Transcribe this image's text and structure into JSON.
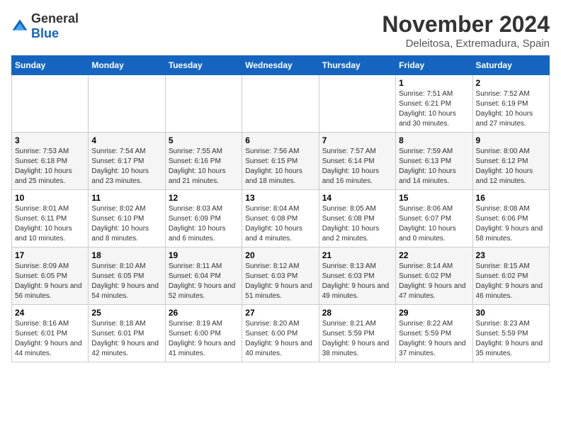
{
  "logo": {
    "general": "General",
    "blue": "Blue"
  },
  "title": {
    "month": "November 2024",
    "location": "Deleitosa, Extremadura, Spain"
  },
  "weekdays": [
    "Sunday",
    "Monday",
    "Tuesday",
    "Wednesday",
    "Thursday",
    "Friday",
    "Saturday"
  ],
  "weeks": [
    [
      {
        "day": "",
        "info": ""
      },
      {
        "day": "",
        "info": ""
      },
      {
        "day": "",
        "info": ""
      },
      {
        "day": "",
        "info": ""
      },
      {
        "day": "",
        "info": ""
      },
      {
        "day": "1",
        "info": "Sunrise: 7:51 AM\nSunset: 6:21 PM\nDaylight: 10 hours and 30 minutes."
      },
      {
        "day": "2",
        "info": "Sunrise: 7:52 AM\nSunset: 6:19 PM\nDaylight: 10 hours and 27 minutes."
      }
    ],
    [
      {
        "day": "3",
        "info": "Sunrise: 7:53 AM\nSunset: 6:18 PM\nDaylight: 10 hours and 25 minutes."
      },
      {
        "day": "4",
        "info": "Sunrise: 7:54 AM\nSunset: 6:17 PM\nDaylight: 10 hours and 23 minutes."
      },
      {
        "day": "5",
        "info": "Sunrise: 7:55 AM\nSunset: 6:16 PM\nDaylight: 10 hours and 21 minutes."
      },
      {
        "day": "6",
        "info": "Sunrise: 7:56 AM\nSunset: 6:15 PM\nDaylight: 10 hours and 18 minutes."
      },
      {
        "day": "7",
        "info": "Sunrise: 7:57 AM\nSunset: 6:14 PM\nDaylight: 10 hours and 16 minutes."
      },
      {
        "day": "8",
        "info": "Sunrise: 7:59 AM\nSunset: 6:13 PM\nDaylight: 10 hours and 14 minutes."
      },
      {
        "day": "9",
        "info": "Sunrise: 8:00 AM\nSunset: 6:12 PM\nDaylight: 10 hours and 12 minutes."
      }
    ],
    [
      {
        "day": "10",
        "info": "Sunrise: 8:01 AM\nSunset: 6:11 PM\nDaylight: 10 hours and 10 minutes."
      },
      {
        "day": "11",
        "info": "Sunrise: 8:02 AM\nSunset: 6:10 PM\nDaylight: 10 hours and 8 minutes."
      },
      {
        "day": "12",
        "info": "Sunrise: 8:03 AM\nSunset: 6:09 PM\nDaylight: 10 hours and 6 minutes."
      },
      {
        "day": "13",
        "info": "Sunrise: 8:04 AM\nSunset: 6:08 PM\nDaylight: 10 hours and 4 minutes."
      },
      {
        "day": "14",
        "info": "Sunrise: 8:05 AM\nSunset: 6:08 PM\nDaylight: 10 hours and 2 minutes."
      },
      {
        "day": "15",
        "info": "Sunrise: 8:06 AM\nSunset: 6:07 PM\nDaylight: 10 hours and 0 minutes."
      },
      {
        "day": "16",
        "info": "Sunrise: 8:08 AM\nSunset: 6:06 PM\nDaylight: 9 hours and 58 minutes."
      }
    ],
    [
      {
        "day": "17",
        "info": "Sunrise: 8:09 AM\nSunset: 6:05 PM\nDaylight: 9 hours and 56 minutes."
      },
      {
        "day": "18",
        "info": "Sunrise: 8:10 AM\nSunset: 6:05 PM\nDaylight: 9 hours and 54 minutes."
      },
      {
        "day": "19",
        "info": "Sunrise: 8:11 AM\nSunset: 6:04 PM\nDaylight: 9 hours and 52 minutes."
      },
      {
        "day": "20",
        "info": "Sunrise: 8:12 AM\nSunset: 6:03 PM\nDaylight: 9 hours and 51 minutes."
      },
      {
        "day": "21",
        "info": "Sunrise: 8:13 AM\nSunset: 6:03 PM\nDaylight: 9 hours and 49 minutes."
      },
      {
        "day": "22",
        "info": "Sunrise: 8:14 AM\nSunset: 6:02 PM\nDaylight: 9 hours and 47 minutes."
      },
      {
        "day": "23",
        "info": "Sunrise: 8:15 AM\nSunset: 6:02 PM\nDaylight: 9 hours and 46 minutes."
      }
    ],
    [
      {
        "day": "24",
        "info": "Sunrise: 8:16 AM\nSunset: 6:01 PM\nDaylight: 9 hours and 44 minutes."
      },
      {
        "day": "25",
        "info": "Sunrise: 8:18 AM\nSunset: 6:01 PM\nDaylight: 9 hours and 42 minutes."
      },
      {
        "day": "26",
        "info": "Sunrise: 8:19 AM\nSunset: 6:00 PM\nDaylight: 9 hours and 41 minutes."
      },
      {
        "day": "27",
        "info": "Sunrise: 8:20 AM\nSunset: 6:00 PM\nDaylight: 9 hours and 40 minutes."
      },
      {
        "day": "28",
        "info": "Sunrise: 8:21 AM\nSunset: 5:59 PM\nDaylight: 9 hours and 38 minutes."
      },
      {
        "day": "29",
        "info": "Sunrise: 8:22 AM\nSunset: 5:59 PM\nDaylight: 9 hours and 37 minutes."
      },
      {
        "day": "30",
        "info": "Sunrise: 8:23 AM\nSunset: 5:59 PM\nDaylight: 9 hours and 35 minutes."
      }
    ]
  ]
}
